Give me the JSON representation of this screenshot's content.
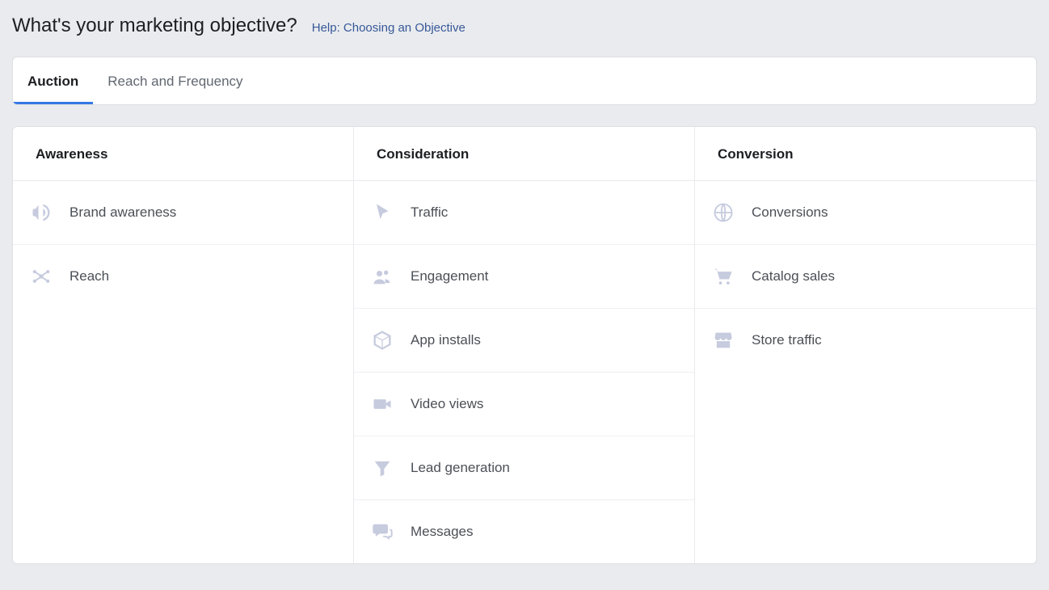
{
  "header": {
    "title": "What's your marketing objective?",
    "help_link": "Help: Choosing an Objective"
  },
  "tabs": {
    "auction": "Auction",
    "reach_frequency": "Reach and Frequency"
  },
  "columns": {
    "awareness": {
      "header": "Awareness",
      "brand_awareness": "Brand awareness",
      "reach": "Reach"
    },
    "consideration": {
      "header": "Consideration",
      "traffic": "Traffic",
      "engagement": "Engagement",
      "app_installs": "App installs",
      "video_views": "Video views",
      "lead_generation": "Lead generation",
      "messages": "Messages"
    },
    "conversion": {
      "header": "Conversion",
      "conversions": "Conversions",
      "catalog_sales": "Catalog sales",
      "store_traffic": "Store traffic"
    }
  }
}
